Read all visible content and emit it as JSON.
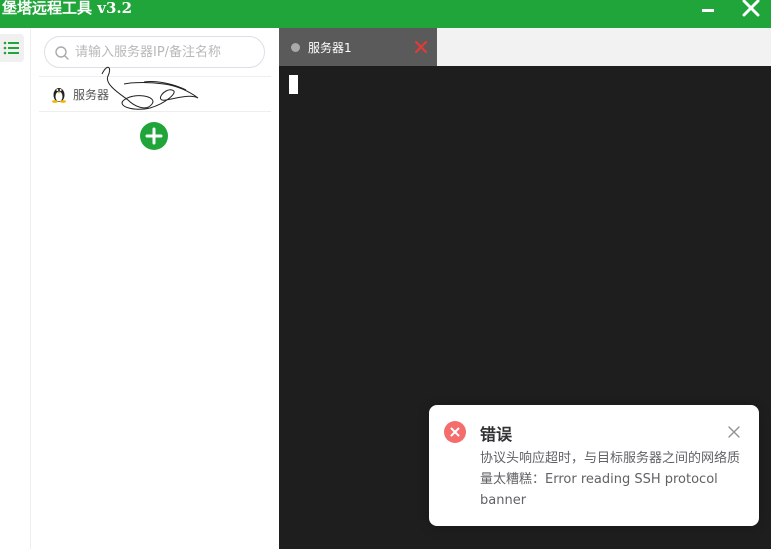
{
  "window": {
    "title": "堡塔远程工具 v3.2"
  },
  "sidebar": {
    "search_placeholder": "请输入服务器IP/备注名称",
    "servers": [
      {
        "label": "服务器"
      }
    ]
  },
  "tabs": [
    {
      "label": "服务器1"
    }
  ],
  "notification": {
    "title": "错误",
    "message": "协议头响应超时，与目标服务器之间的网络质量太糟糕：Error reading SSH protocol banner"
  },
  "colors": {
    "brand": "#20a53a",
    "terminal_bg": "#1e1e1e",
    "error": "#f56c6c",
    "tab_close": "#e53935"
  },
  "icons": [
    "menu-icon",
    "search-icon",
    "linux-icon",
    "plus-icon",
    "close-icon",
    "error-icon",
    "minimize-icon"
  ]
}
